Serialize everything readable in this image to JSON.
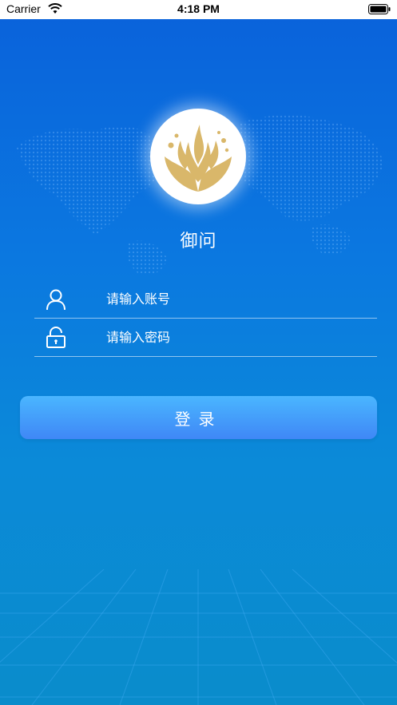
{
  "status_bar": {
    "carrier": "Carrier",
    "time": "4:18 PM"
  },
  "app": {
    "name": "御问"
  },
  "form": {
    "account_placeholder": "请输入账号",
    "password_placeholder": "请输入密码",
    "login_label": "登录"
  },
  "colors": {
    "background_top": "#0a63db",
    "background_bottom": "#0a8ccb",
    "button_top": "#4ab6ff",
    "button_bottom": "#3f87f6",
    "logo_gold": "#d9b76a"
  },
  "icons": {
    "wifi": "wifi-icon",
    "battery": "battery-icon",
    "user": "user-icon",
    "lock": "lock-icon",
    "logo": "flame-lotus-logo"
  }
}
